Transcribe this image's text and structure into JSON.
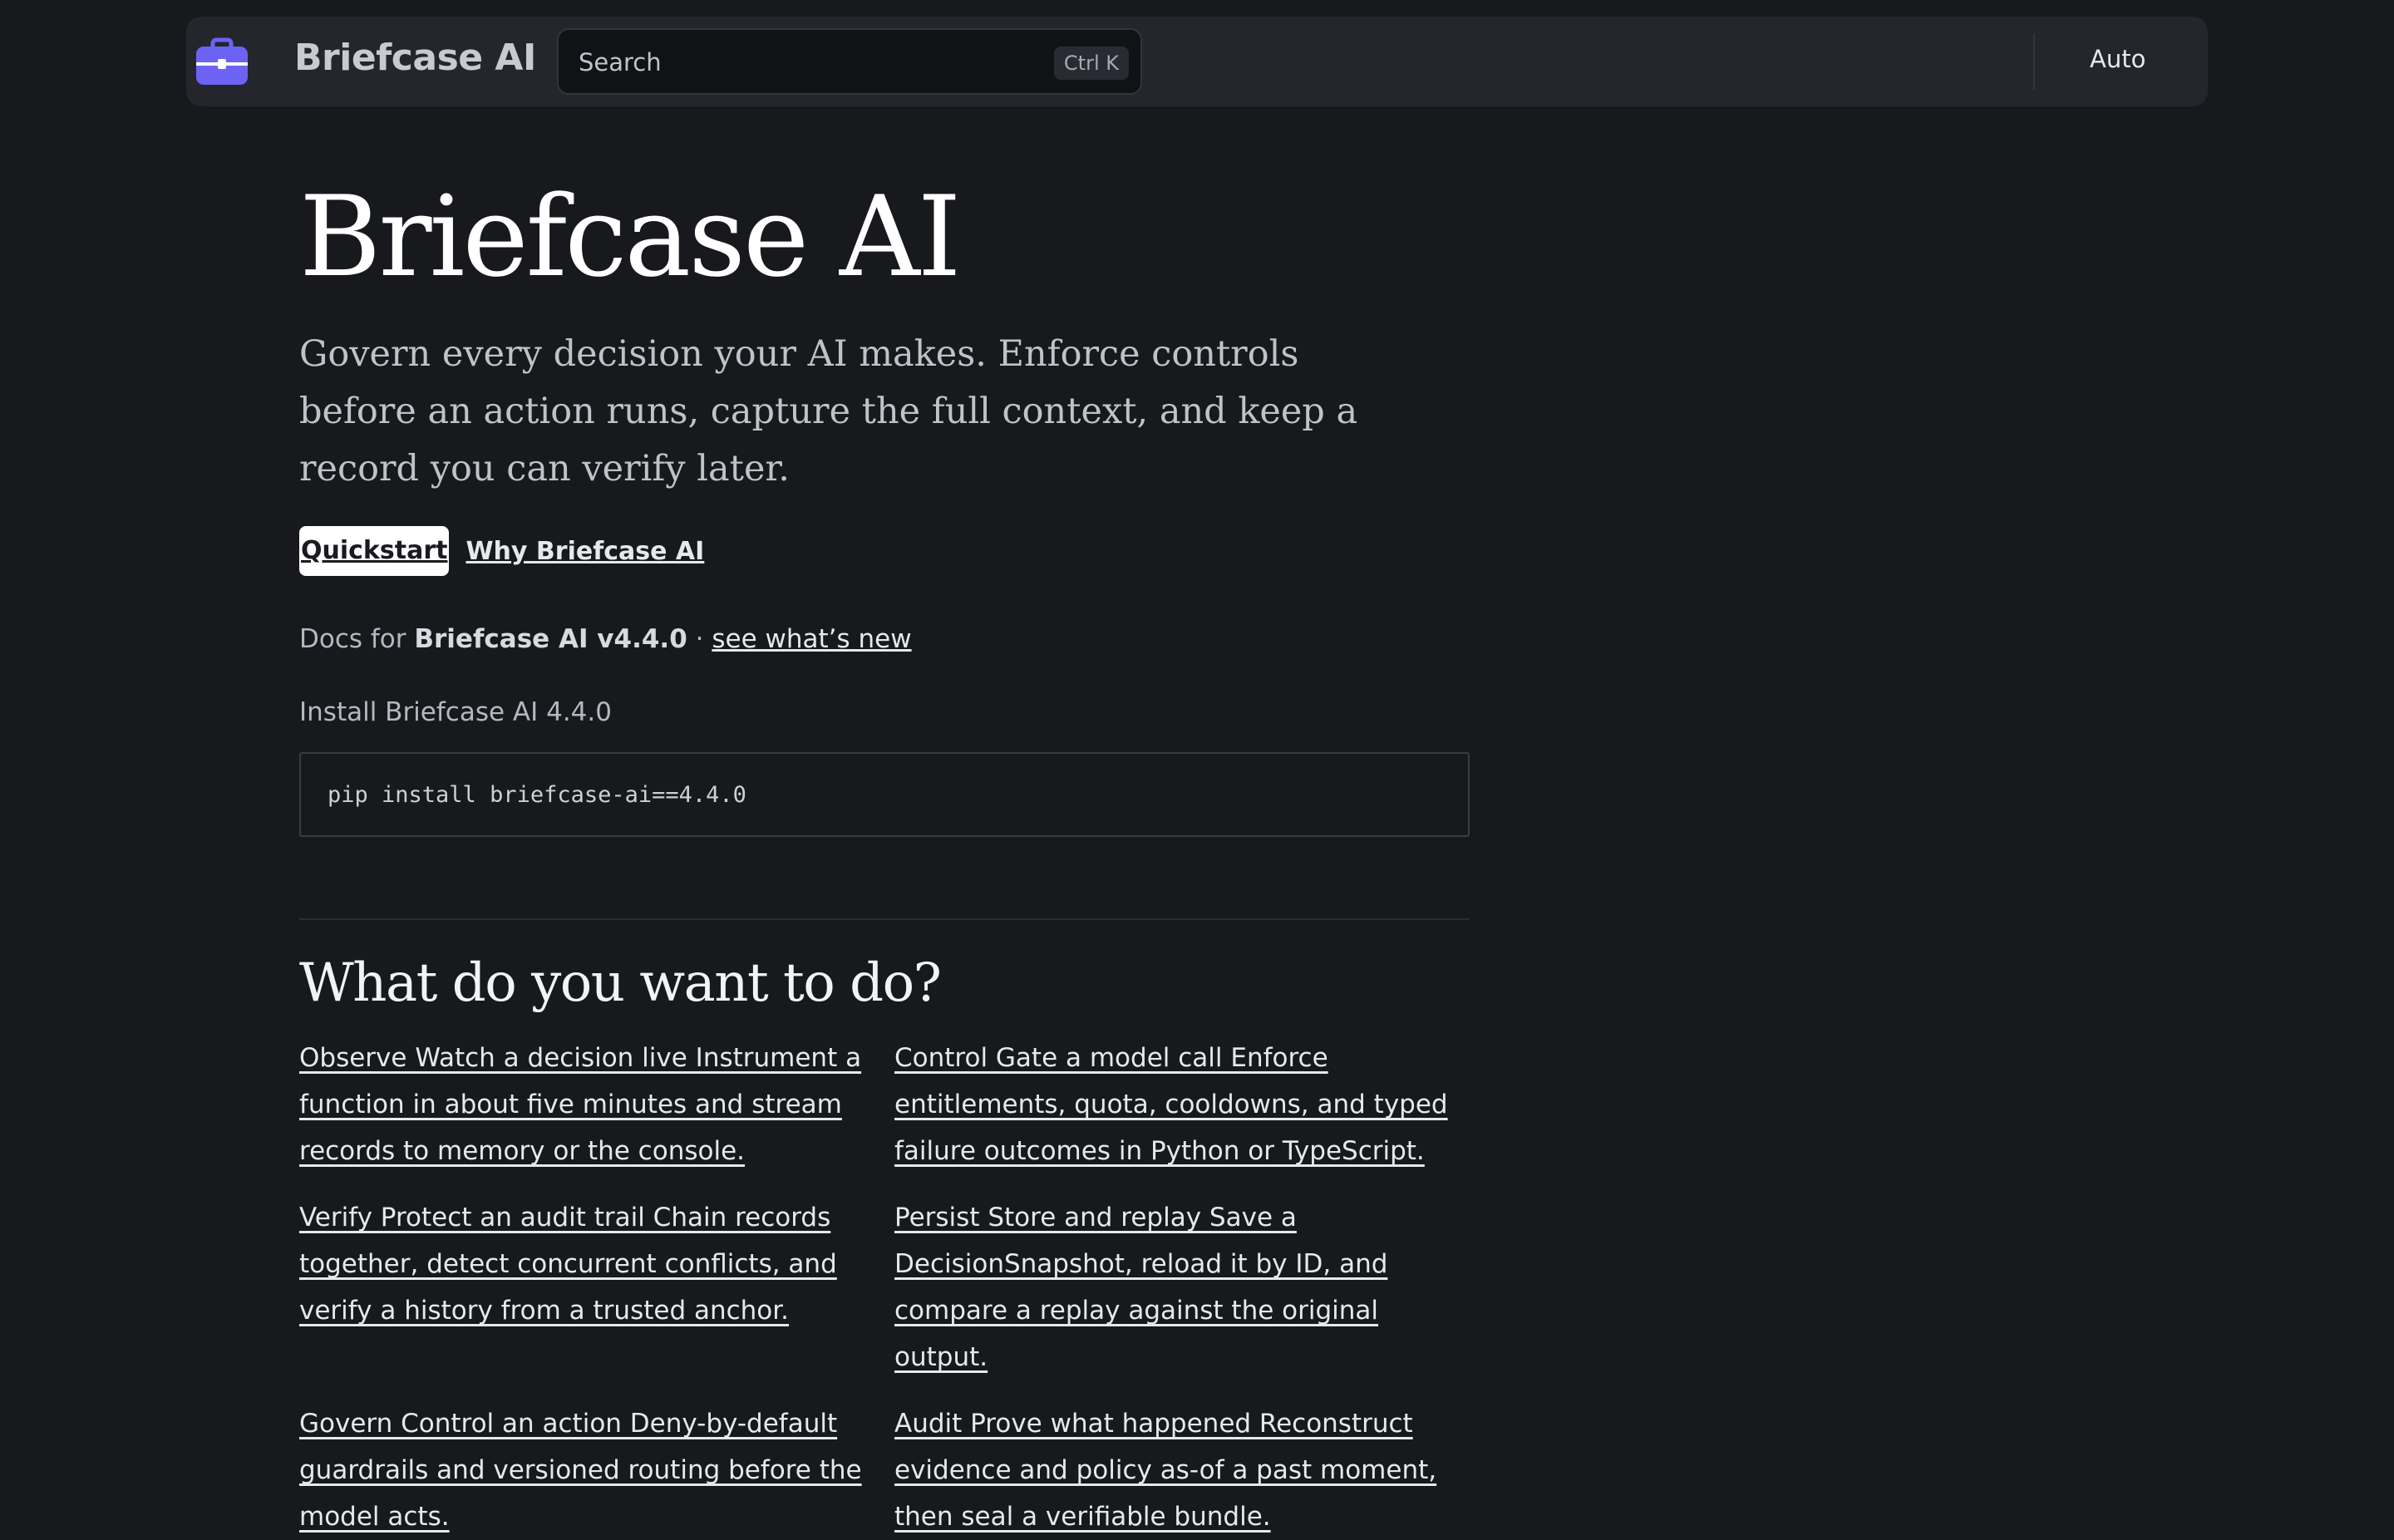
{
  "header": {
    "brand": "Briefcase AI",
    "search_label": "Search",
    "search_shortcut": "Ctrl K",
    "theme_toggle": "Auto",
    "logo_icon": "briefcase-icon",
    "accent_color": "#6c63f5"
  },
  "hero": {
    "title": "Briefcase AI",
    "lead": "Govern every decision your AI makes. Enforce controls before an action runs, capture the full context, and keep a record you can verify later.",
    "primary_cta": "Quickstart",
    "secondary_cta": "Why Briefcase AI"
  },
  "docs": {
    "prefix": "Docs for",
    "version": "Briefcase AI v4.4.0",
    "separator": "·",
    "whats_new_link": "see what’s new"
  },
  "install": {
    "label": "Install Briefcase AI 4.4.0",
    "command": "pip install briefcase-ai==4.4.0"
  },
  "tasks": {
    "title": "What do you want to do?",
    "items": [
      {
        "text": "Observe Watch a decision live Instrument a function in about five minutes and stream records to memory or the console."
      },
      {
        "text": "Control Gate a model call Enforce entitlements, quota, cooldowns, and typed failure outcomes in Python or TypeScript."
      },
      {
        "text": "Verify Protect an audit trail Chain records together, detect concurrent conflicts, and verify a history from a trusted anchor."
      },
      {
        "text": "Persist Store and replay Save a DecisionSnapshot, reload it by ID, and compare a replay against the original output."
      },
      {
        "text": "Govern Control an action Deny-by-default guardrails and versioned routing before the model acts."
      },
      {
        "text": "Audit Prove what happened Reconstruct evidence and policy as-of a past moment, then seal a verifiable bundle."
      }
    ]
  }
}
